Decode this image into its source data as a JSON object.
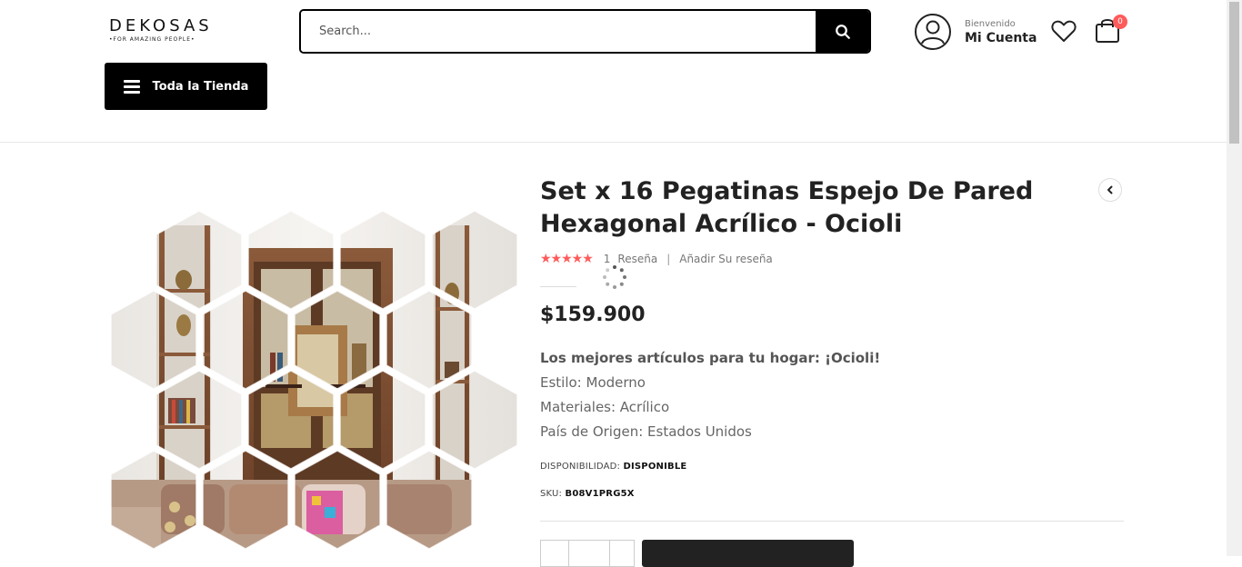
{
  "header": {
    "logo": {
      "brand": "DEKOSAS",
      "tagline": "•FOR AMAZING PEOPLE•"
    },
    "search": {
      "placeholder": "Search...",
      "value": ""
    },
    "account": {
      "welcome": "Bienvenido",
      "label": "Mi Cuenta"
    },
    "cart": {
      "count": "0"
    },
    "store_button": {
      "label": "Toda la Tienda"
    }
  },
  "product": {
    "title": "Set x 16 Pegatinas Espejo De Pared Hexagonal Acrílico - Ocioli",
    "rating": {
      "stars": 5,
      "review_count": "1",
      "review_label": "Reseña",
      "add_review": "Añadir Su reseña"
    },
    "price": "$159.900",
    "description": {
      "headline": "Los mejores artículos para tu hogar: ¡Ocioli!",
      "lines": [
        "Estilo: Moderno",
        "Materiales: Acrílico",
        "País de Origen: Estados Unidos"
      ]
    },
    "availability": {
      "label": "DISPONIBILIDAD:",
      "value": "DISPONIBLE"
    },
    "sku": {
      "label": "SKU:",
      "value": "B08V1PRG5X"
    }
  },
  "colors": {
    "accent": "#ff5b5b",
    "primary": "#000000",
    "text": "#222222"
  },
  "icons": [
    "search-icon",
    "user-icon",
    "heart-icon",
    "shopping-bag-icon",
    "menu-icon",
    "chevron-left-icon",
    "loading-spinner-icon",
    "star-icon"
  ]
}
